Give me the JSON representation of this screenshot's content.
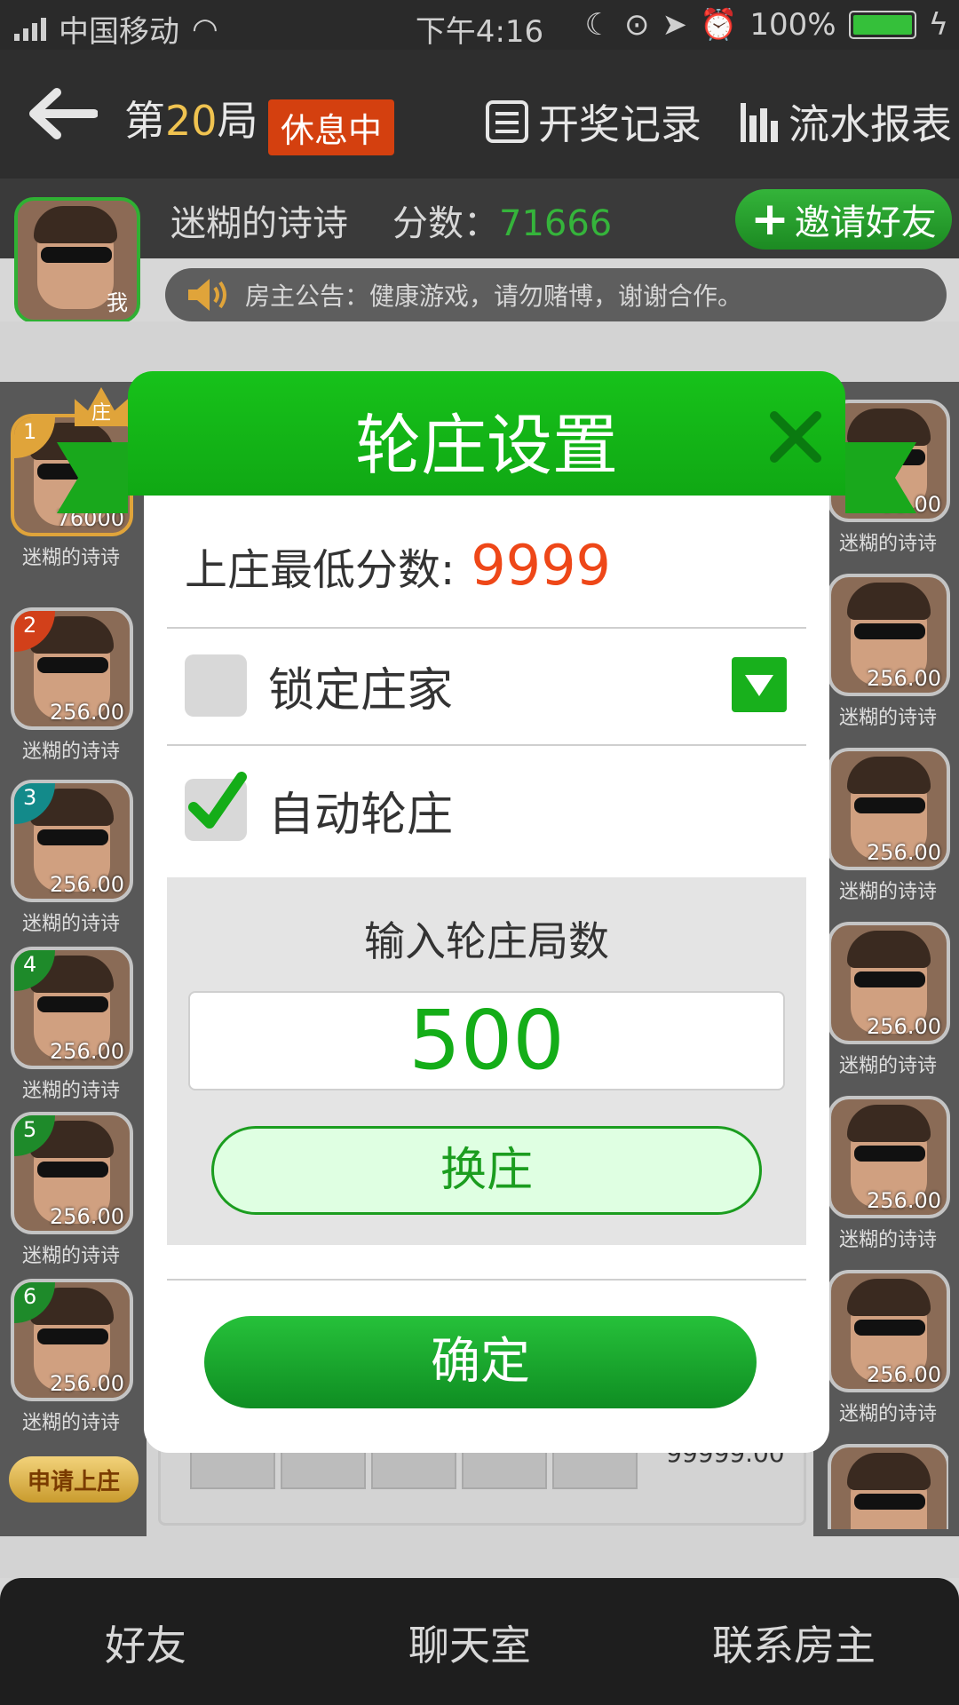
{
  "status_bar": {
    "carrier": "中国移动",
    "time": "下午4:16",
    "battery": "100%"
  },
  "header": {
    "round_prefix": "第",
    "round_number": "20",
    "round_suffix": "局",
    "status_badge": "休息中",
    "records_label": "开奖记录",
    "report_label": "流水报表"
  },
  "player": {
    "name": "迷糊的诗诗",
    "score_label": "分数：",
    "score": "71666",
    "self_tag": "我",
    "invite_label": "邀请好友"
  },
  "announcement": "房主公告：健康游戏，请勿赌博，谢谢合作。",
  "left_seats": [
    {
      "rank": "1",
      "score": "76000",
      "name": "迷糊的诗诗",
      "banker": "庄"
    },
    {
      "rank": "2",
      "score": "256.00",
      "name": "迷糊的诗诗"
    },
    {
      "rank": "3",
      "score": "256.00",
      "name": "迷糊的诗诗"
    },
    {
      "rank": "4",
      "score": "256.00",
      "name": "迷糊的诗诗"
    },
    {
      "rank": "5",
      "score": "256.00",
      "name": "迷糊的诗诗"
    },
    {
      "rank": "6",
      "score": "256.00",
      "name": "迷糊的诗诗"
    }
  ],
  "right_seats": [
    {
      "score": "00.00",
      "name": "迷糊的诗诗"
    },
    {
      "score": "256.00",
      "name": "迷糊的诗诗"
    },
    {
      "score": "256.00",
      "name": "迷糊的诗诗"
    },
    {
      "score": "256.00",
      "name": "迷糊的诗诗"
    },
    {
      "score": "256.00",
      "name": "迷糊的诗诗"
    },
    {
      "score": "256.00",
      "name": "迷糊的诗诗"
    }
  ],
  "apply_button": "申请上庄",
  "table_amount": "99999.00",
  "dialog": {
    "title": "轮庄设置",
    "min_score_label": "上庄最低分数:",
    "min_score_value": "9999",
    "lock_label": "锁定庄家",
    "auto_label": "自动轮庄",
    "rounds_label": "输入轮庄局数",
    "rounds_value": "500",
    "swap_label": "换庄",
    "confirm_label": "确定"
  },
  "bottom_nav": {
    "friends": "好友",
    "chat": "聊天室",
    "contact": "联系房主"
  },
  "colors": {
    "brand_green": "#18b01c",
    "score_green": "#35b43b",
    "highlight_red": "#ee4718",
    "badge_red": "#d4400f"
  }
}
